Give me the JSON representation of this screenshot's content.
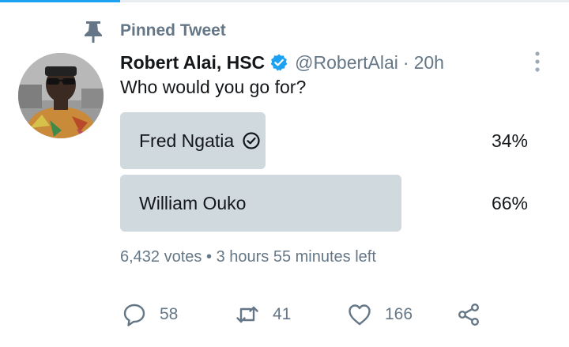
{
  "pin": {
    "label": "Pinned Tweet",
    "icon": "pin-icon"
  },
  "tweet": {
    "author_name": "Robert Alai, HSC",
    "verified": true,
    "handle": "@RobertAlai",
    "separator": "·",
    "time": "20h",
    "text": "Who would you go for?"
  },
  "poll": {
    "options": [
      {
        "label": "Fred Ngatia",
        "percent_text": "34%",
        "percent": 34,
        "selected": true
      },
      {
        "label": "William Ouko",
        "percent_text": "66%",
        "percent": 66,
        "selected": false
      }
    ],
    "votes_text": "6,432 votes",
    "meta_separator": "•",
    "time_left": "3 hours 55 minutes left"
  },
  "actions": {
    "reply": {
      "count": "58",
      "icon": "reply-icon"
    },
    "retweet": {
      "count": "41",
      "icon": "retweet-icon"
    },
    "like": {
      "count": "166",
      "icon": "heart-icon"
    },
    "share": {
      "icon": "share-icon"
    }
  },
  "colors": {
    "accent": "#1da1f2",
    "secondary_text": "#657786",
    "poll_bar": "#cfd9de",
    "primary_text": "#14171a"
  }
}
